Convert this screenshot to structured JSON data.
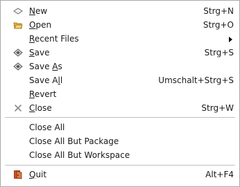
{
  "menu": {
    "items_top": [
      {
        "pre": "",
        "ul": "N",
        "post": "ew",
        "shortcut": "Strg+N",
        "icon": "new-file-icon"
      },
      {
        "pre": "",
        "ul": "O",
        "post": "pen",
        "shortcut": "Strg+O",
        "icon": "open-folder-icon"
      },
      {
        "pre": "",
        "ul": "R",
        "post": "ecent Files",
        "shortcut": "",
        "icon": ""
      },
      {
        "pre": "",
        "ul": "S",
        "post": "ave",
        "shortcut": "Strg+S",
        "icon": "save-icon"
      },
      {
        "pre": "Save ",
        "ul": "A",
        "post": "s",
        "shortcut": "",
        "icon": "save-as-icon"
      },
      {
        "pre": "Save A",
        "ul": "l",
        "post": "l",
        "shortcut": "Umschalt+Strg+S",
        "icon": ""
      },
      {
        "pre": "",
        "ul": "R",
        "post": "evert",
        "shortcut": "",
        "icon": ""
      },
      {
        "pre": "",
        "ul": "C",
        "post": "lose",
        "shortcut": "Strg+W",
        "icon": "close-icon"
      }
    ],
    "items_middle": [
      {
        "label": "Close All"
      },
      {
        "label": "Close All But Package"
      },
      {
        "label": "Close All But Workspace"
      }
    ],
    "quit": {
      "pre": "",
      "ul": "Q",
      "post": "uit",
      "shortcut": "Alt+F4",
      "icon": "quit-icon"
    }
  }
}
